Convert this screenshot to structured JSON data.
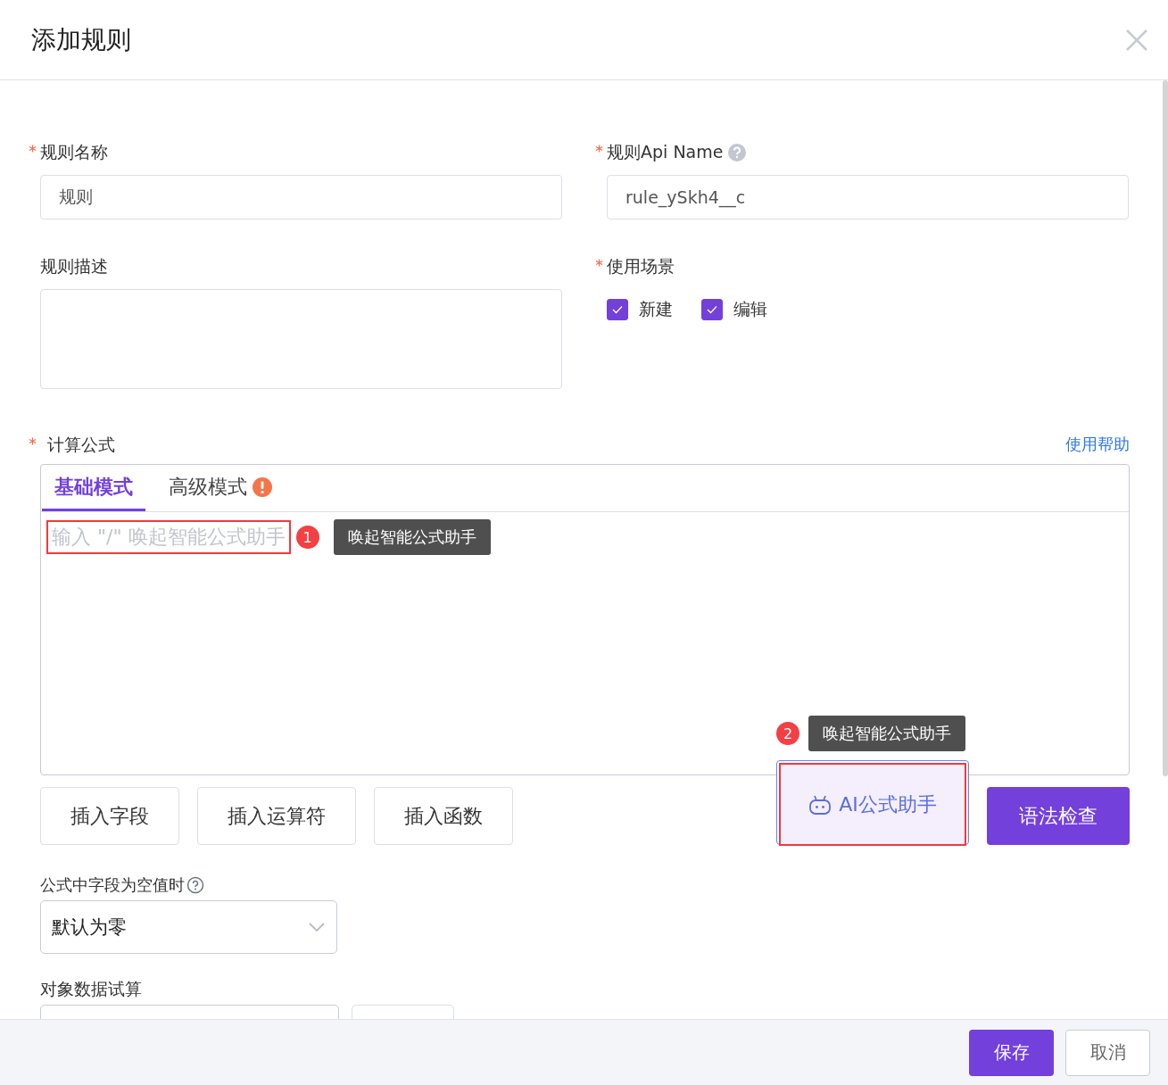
{
  "dialog": {
    "title": "添加规则"
  },
  "fields": [
    {
      "label": "规则名称",
      "required": true,
      "kind": "input",
      "value": "规则"
    },
    {
      "label": "规则Api Name",
      "required": true,
      "kind": "input",
      "value": "rule_ySkh4__c",
      "help": true
    },
    {
      "label": "规则描述",
      "required": false,
      "kind": "textarea"
    },
    {
      "label": "使用场景",
      "required": true,
      "kind": "checkboxes",
      "options": [
        {
          "label": "新建",
          "checked": true
        },
        {
          "label": "编辑",
          "checked": true
        }
      ]
    }
  ],
  "formula": {
    "label": "计算公式",
    "required": true,
    "help_link": "使用帮助",
    "tabs": [
      {
        "label": "基础模式",
        "selected": true,
        "warning": false
      },
      {
        "label": "高级模式",
        "selected": false,
        "warning": true
      }
    ],
    "placeholder": "输入 \"/\" 唤起智能公式助手",
    "annotations": [
      {
        "number": "1",
        "tooltip": "唤起智能公式助手"
      },
      {
        "number": "2",
        "tooltip": "唤起智能公式助手"
      }
    ],
    "insert_buttons": [
      "插入字段",
      "插入运算符",
      "插入函数"
    ],
    "ai_button": "AI公式助手",
    "check_button": "语法检查"
  },
  "null_setting": {
    "label": "公式中字段为空值时",
    "value": "默认为零"
  },
  "trial": {
    "label": "对象数据试算"
  },
  "footer": {
    "buttons": [
      {
        "label": "保存",
        "kind": "primary"
      },
      {
        "label": "取消",
        "kind": "default"
      }
    ]
  }
}
